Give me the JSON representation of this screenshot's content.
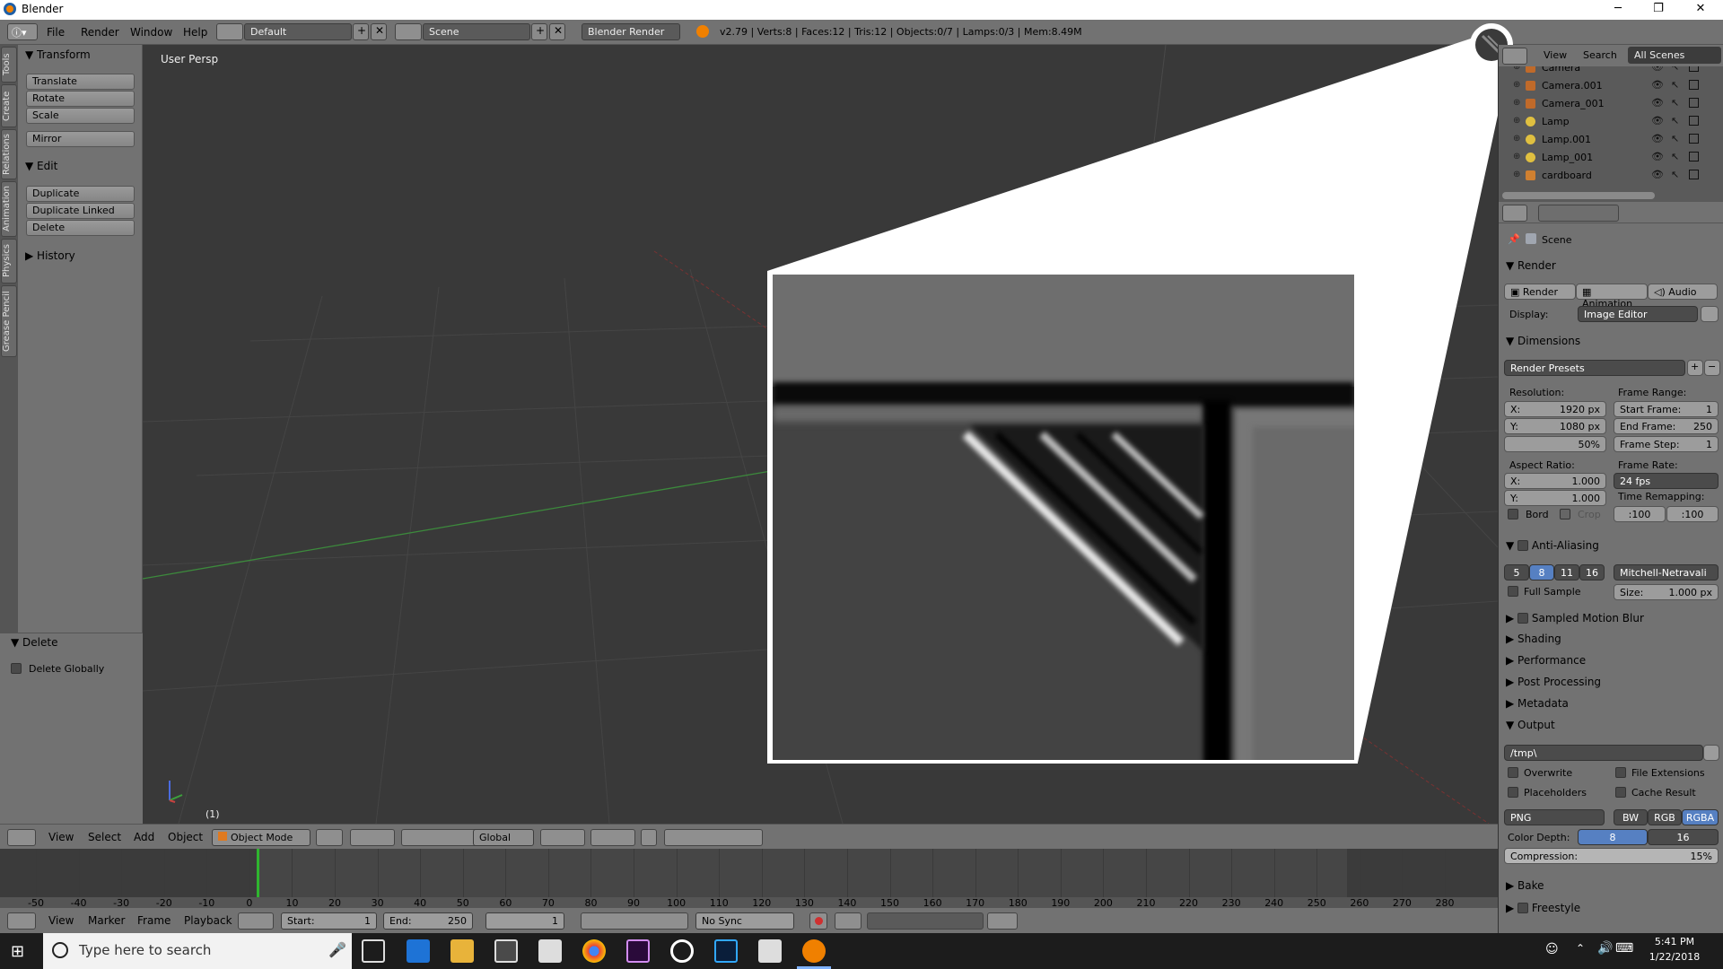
{
  "window": {
    "title": "Blender",
    "minimize": "─",
    "maximize": "❐",
    "close": "✕"
  },
  "topbar": {
    "menus": [
      "File",
      "Render",
      "Window",
      "Help"
    ],
    "layout": "Default",
    "scene": "Scene",
    "engine": "Blender Render",
    "stats": "v2.79 | Verts:8 | Faces:12 | Tris:12 | Objects:0/7 | Lamps:0/3 | Mem:8.49M"
  },
  "left_tabs": [
    "Tools",
    "Create",
    "Relations",
    "Animation",
    "Physics",
    "Grease Pencil"
  ],
  "tool_shelf": {
    "transform_header": "Transform",
    "transform_buttons": [
      "Translate",
      "Rotate",
      "Scale"
    ],
    "mirror": "Mirror",
    "edit_header": "Edit",
    "edit_buttons": [
      "Duplicate",
      "Duplicate Linked",
      "Delete"
    ],
    "history_header": "History"
  },
  "redo_panel": {
    "header": "Delete",
    "option": "Delete Globally"
  },
  "viewport": {
    "label": "User Persp",
    "frame": "(1)"
  },
  "view_header": {
    "menus": [
      "View",
      "Select",
      "Add",
      "Object"
    ],
    "mode": "Object Mode",
    "orientation": "Global"
  },
  "timeline": {
    "ticks": [
      "-50",
      "-40",
      "-30",
      "-20",
      "-10",
      "0",
      "10",
      "20",
      "30",
      "40",
      "50",
      "60",
      "70",
      "80",
      "90",
      "100",
      "110",
      "120",
      "130",
      "140",
      "150",
      "160",
      "170",
      "180",
      "190",
      "200",
      "210",
      "220",
      "230",
      "240",
      "250",
      "260",
      "270",
      "280"
    ],
    "current_frame": 1
  },
  "timeline_header": {
    "menus": [
      "View",
      "Marker",
      "Frame",
      "Playback"
    ],
    "start_label": "Start:",
    "start_value": "1",
    "end_label": "End:",
    "end_value": "250",
    "current": "1",
    "sync": "No Sync"
  },
  "outliner": {
    "menus": [
      "View",
      "Search"
    ],
    "filter": "All Scenes",
    "items": [
      "Camera",
      "Camera.001",
      "Camera_001",
      "Lamp",
      "Lamp.001",
      "Lamp_001",
      "cardboard"
    ]
  },
  "properties": {
    "scene": "Scene",
    "render_header": "Render",
    "render_buttons": [
      "Render",
      "Animation",
      "Audio"
    ],
    "display_label": "Display:",
    "display_value": "Image Editor",
    "dimensions_header": "Dimensions",
    "render_presets": "Render Presets",
    "resolution_label": "Resolution:",
    "res_x_label": "X:",
    "res_x": "1920 px",
    "res_y_label": "Y:",
    "res_y": "1080 px",
    "res_pct": "50%",
    "frame_range_label": "Frame Range:",
    "start_frame_label": "Start Frame:",
    "start_frame": "1",
    "end_frame_label": "End Frame:",
    "end_frame": "250",
    "frame_step_label": "Frame Step:",
    "frame_step": "1",
    "aspect_label": "Aspect Ratio:",
    "asp_x_label": "X:",
    "asp_x": "1.000",
    "asp_y_label": "Y:",
    "asp_y": "1.000",
    "frame_rate_label": "Frame Rate:",
    "frame_rate": "24 fps",
    "time_remap_label": "Time Remapping:",
    "remap_old": ":100",
    "remap_new": ":100",
    "bord": "Bord",
    "crop": "Crop",
    "aa_header": "Anti-Aliasing",
    "aa_samples": [
      "5",
      "8",
      "11",
      "16"
    ],
    "aa_selected": "8",
    "aa_filter": "Mitchell-Netravali",
    "full_sample": "Full Sample",
    "size_label": "Size:",
    "size_value": "1.000 px",
    "sections": [
      "Sampled Motion Blur",
      "Shading",
      "Performance",
      "Post Processing",
      "Metadata"
    ],
    "output_header": "Output",
    "output_path": "/tmp\\",
    "overwrite": "Overwrite",
    "file_extensions": "File Extensions",
    "placeholders": "Placeholders",
    "cache_result": "Cache Result",
    "format": "PNG",
    "color_modes": [
      "BW",
      "RGB",
      "RGBA"
    ],
    "color_depth_label": "Color Depth:",
    "depth_8": "8",
    "depth_16": "16",
    "compression_label": "Compression:",
    "compression": "15%",
    "bake": "Bake",
    "freestyle": "Freestyle"
  },
  "taskbar": {
    "search_placeholder": "Type here to search",
    "time": "5:41 PM",
    "date": "1/22/2018"
  },
  "colors": {
    "accent": "#5680c2",
    "blender_orange": "#f08000",
    "grid_green": "#3c8a3c",
    "grid_red": "#7a3232"
  }
}
